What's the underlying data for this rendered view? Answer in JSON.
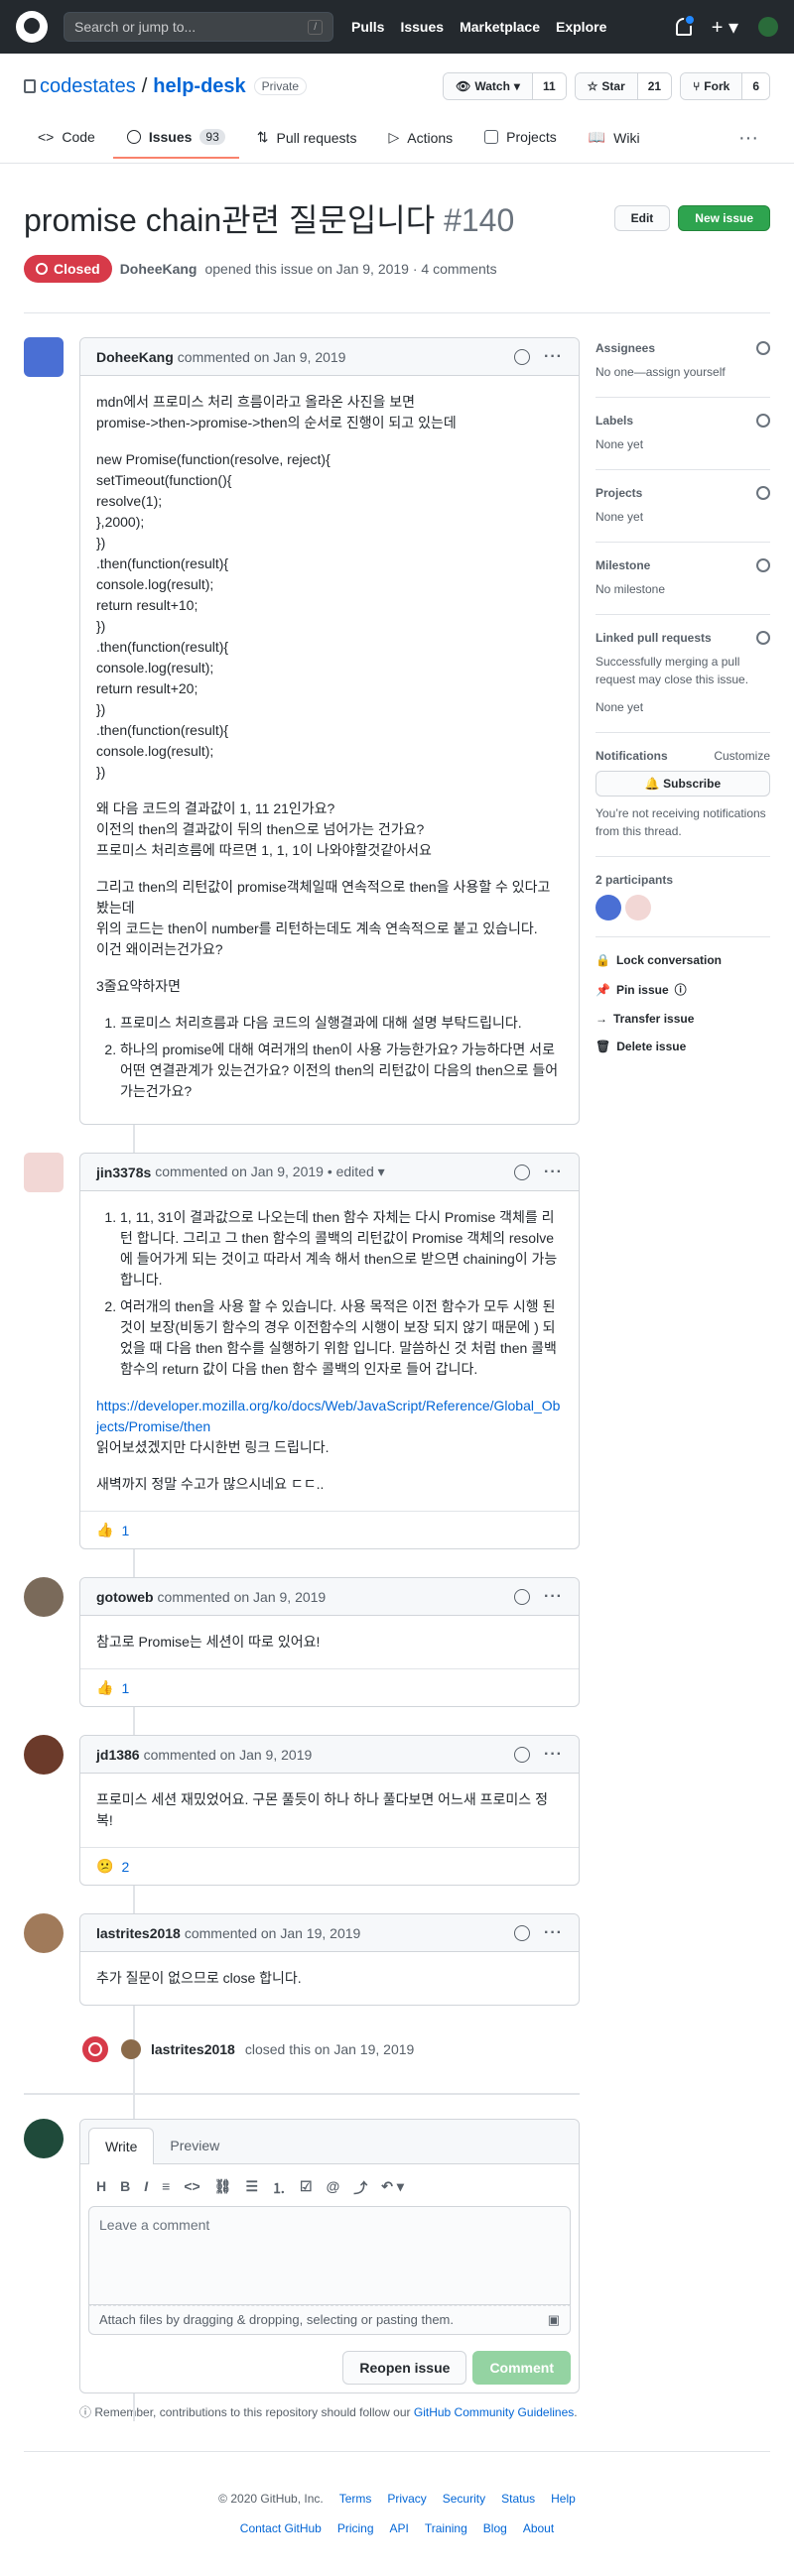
{
  "header": {
    "search_placeholder": "Search or jump to...",
    "slash": "/",
    "nav": [
      "Pulls",
      "Issues",
      "Marketplace",
      "Explore"
    ]
  },
  "repo": {
    "owner": "codestates",
    "sep": "/",
    "name": "help-desk",
    "visibility": "Private",
    "watch_label": "Watch",
    "watch_count": "11",
    "star_label": "Star",
    "star_count": "21",
    "fork_label": "Fork",
    "fork_count": "6"
  },
  "tabs": [
    {
      "label": "Code"
    },
    {
      "label": "Issues",
      "count": "93"
    },
    {
      "label": "Pull requests"
    },
    {
      "label": "Actions"
    },
    {
      "label": "Projects"
    },
    {
      "label": "Wiki"
    }
  ],
  "issue": {
    "title": "promise chain관련 질문입니다",
    "number": "#140",
    "edit": "Edit",
    "new_issue": "New issue",
    "state": "Closed",
    "author": "DoheeKang",
    "opened": "opened this issue on Jan 9, 2019 · 4 comments"
  },
  "comments": [
    {
      "author": "DoheeKang",
      "meta": "commented on Jan 9, 2019",
      "p1": "mdn에서 프로미스 처리 흐름이라고 올라온 사진을 보면\npromise->then->promise->then의 순서로 진행이 되고 있는데",
      "code": "new Promise(function(resolve, reject){\nsetTimeout(function(){\nresolve(1);\n},2000);\n})\n.then(function(result){\nconsole.log(result);\nreturn result+10;\n})\n.then(function(result){\nconsole.log(result);\nreturn result+20;\n})\n.then(function(result){\nconsole.log(result);\n})",
      "p2": "왜 다음 코드의 결과값이 1, 11 21인가요?\n이전의 then의 결과값이 뒤의 then으로 넘어가는 건가요?\n프로미스 처리흐름에 따르면 1, 1, 1이 나와야할것같아서요",
      "p3": "그리고 then의 리턴값이 promise객체일때 연속적으로 then을 사용할 수 있다고 봤는데\n위의 코드는 then이 number를 리턴하는데도 계속 연속적으로 붙고 있습니다.\n이건 왜이러는건가요?",
      "p4": "3줄요약하자면",
      "list": [
        "프로미스 처리흐름과 다음 코드의 실행결과에 대해 설명 부탁드립니다.",
        "하나의 promise에 대해 여러개의 then이 사용 가능한가요? 가능하다면 서로 어떤 연결관계가 있는건가요? 이전의 then의 리턴값이 다음의 then으로 들어가는건가요?"
      ]
    },
    {
      "author": "jin3378s",
      "meta": "commented on Jan 9, 2019 • edited ▾",
      "list": [
        "1, 11, 31이 결과값으로 나오는데 then 함수 자체는 다시 Promise 객체를 리턴 합니다. 그리고 그 then 함수의 콜백의 리턴값이 Promise 객체의 resolve 에 들어가게 되는 것이고 따라서 계속 해서 then으로 받으면 chaining이 가능 합니다.",
        "여러개의 then을 사용 할 수 있습니다. 사용 목적은 이전 함수가 모두 시행 된 것이 보장(비동기 함수의 경우 이전함수의 시행이 보장 되지 않기 때문에 ) 되었을 때 다음 then 함수를 실행하기 위함 입니다. 말씀하신 것 처럼 then 콜백 함수의 return 값이 다음 then 함수 콜백의 인자로 들어 갑니다."
      ],
      "link": "https://developer.mozilla.org/ko/docs/Web/JavaScript/Reference/Global_Objects/Promise/then",
      "p1": "읽어보셨겠지만 다시한번 링크 드립니다.",
      "p2": "새벽까지 정말 수고가 많으시네요 ㄷㄷ..",
      "reaction": "👍",
      "reaction_count": "1"
    },
    {
      "author": "gotoweb",
      "meta": "commented on Jan 9, 2019",
      "p1": "참고로 Promise는 세션이 따로 있어요!",
      "reaction": "👍",
      "reaction_count": "1"
    },
    {
      "author": "jd1386",
      "meta": "commented on Jan 9, 2019",
      "p1": "프로미스 세션 재밌었어요. 구몬 풀듯이 하나 하나 풀다보면 어느새 프로미스 정복!",
      "reaction": "😕",
      "reaction_count": "2"
    },
    {
      "author": "lastrites2018",
      "meta": "commented on Jan 19, 2019",
      "p1": "추가 질문이 없으므로 close 합니다."
    }
  ],
  "event": {
    "actor": "lastrites2018",
    "text": "closed this on Jan 19, 2019"
  },
  "editor": {
    "write": "Write",
    "preview": "Preview",
    "placeholder": "Leave a comment",
    "attach": "Attach files by dragging & dropping, selecting or pasting them.",
    "reopen": "Reopen issue",
    "comment": "Comment",
    "tip_pre": "Remember, contributions to this repository should follow our ",
    "tip_link": "GitHub Community Guidelines",
    "tip_post": "."
  },
  "sidebar": {
    "assignees_h": "Assignees",
    "assignees_v": "No one—assign yourself",
    "labels_h": "Labels",
    "labels_v": "None yet",
    "projects_h": "Projects",
    "projects_v": "None yet",
    "milestone_h": "Milestone",
    "milestone_v": "No milestone",
    "linked_h": "Linked pull requests",
    "linked_desc": "Successfully merging a pull request may close this issue.",
    "linked_v": "None yet",
    "notif_h": "Notifications",
    "notif_customize": "Customize",
    "subscribe": "Subscribe",
    "notif_desc": "You’re not receiving notifications from this thread.",
    "participants": "2 participants",
    "lock": "Lock conversation",
    "pin": "Pin issue",
    "transfer": "Transfer issue",
    "delete": "Delete issue"
  },
  "footer": {
    "copyright": "© 2020 GitHub, Inc.",
    "row1": [
      "Terms",
      "Privacy",
      "Security",
      "Status",
      "Help"
    ],
    "row2": [
      "Contact GitHub",
      "Pricing",
      "API",
      "Training",
      "Blog",
      "About"
    ]
  },
  "colors": {
    "accent": "#0366d6",
    "closed": "#d73a49",
    "green": "#2ea44f"
  }
}
